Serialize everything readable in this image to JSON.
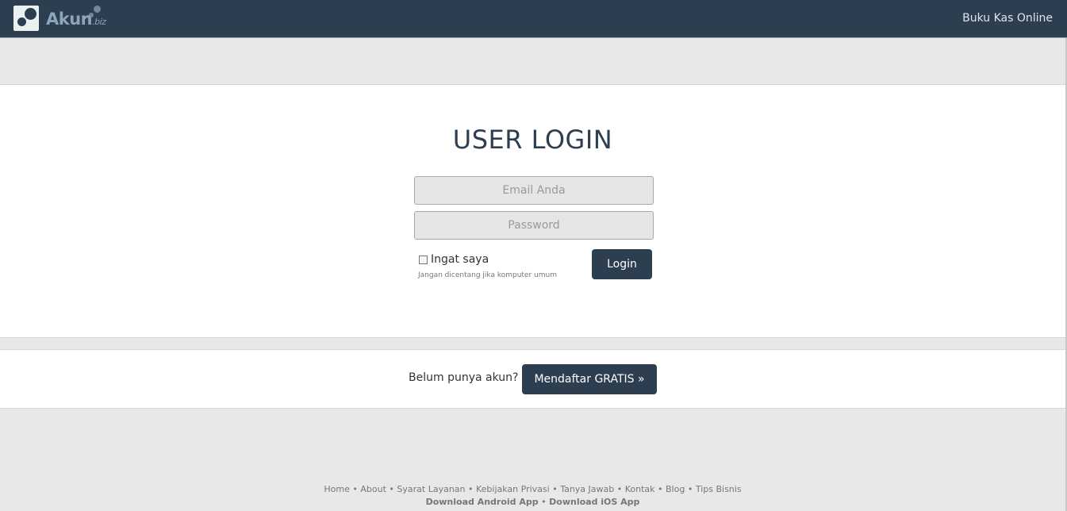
{
  "header": {
    "logo_text": "Akun",
    "logo_suffix": ".biz",
    "tagline": "Buku Kas Online"
  },
  "login": {
    "title": "USER LOGIN",
    "email_placeholder": "Email Anda",
    "password_placeholder": "Password",
    "remember_label": "Ingat saya",
    "remember_checked": false,
    "remember_hint": "Jangan dicentang jika komputer umum",
    "submit_label": "Login"
  },
  "signup": {
    "question": "Belum punya akun?",
    "button_label": "Mendaftar GRATIS »"
  },
  "footer": {
    "links": [
      "Home",
      "About",
      "Syarat Layanan",
      "Kebijakan Privasi",
      "Tanya Jawab",
      "Kontak",
      "Blog",
      "Tips Bisnis"
    ],
    "separator": " • ",
    "app_links": [
      "Download Android App",
      "Download iOS App"
    ]
  },
  "colors": {
    "navy": "#2c3e50",
    "page_bg": "#e8e8e8",
    "panel_bg": "#ffffff"
  }
}
